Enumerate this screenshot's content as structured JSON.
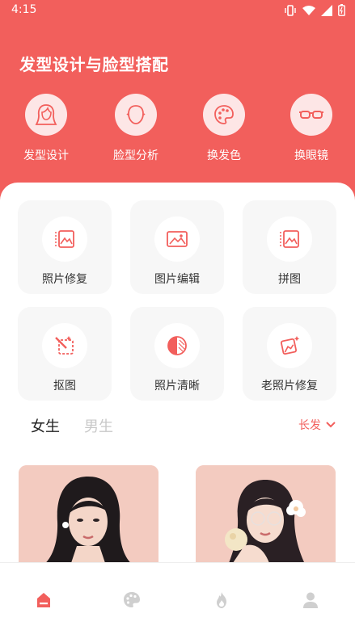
{
  "status_bar": {
    "time": "4:15"
  },
  "page": {
    "title": "发型设计与脸型搭配"
  },
  "features": [
    {
      "label": "发型设计",
      "icon": "woman-hair-icon"
    },
    {
      "label": "脸型分析",
      "icon": "face-shape-icon"
    },
    {
      "label": "换发色",
      "icon": "palette-icon"
    },
    {
      "label": "换眼镜",
      "icon": "glasses-icon"
    }
  ],
  "tools": [
    {
      "label": "照片修复",
      "icon": "photo-restore-icon"
    },
    {
      "label": "图片编辑",
      "icon": "image-edit-icon"
    },
    {
      "label": "拼图",
      "icon": "collage-icon"
    },
    {
      "label": "抠图",
      "icon": "cutout-icon"
    },
    {
      "label": "照片清晰",
      "icon": "sharpen-icon"
    },
    {
      "label": "老照片修复",
      "icon": "old-photo-restore-icon"
    }
  ],
  "gender_tabs": {
    "female": "女生",
    "male": "男生",
    "selected": "female"
  },
  "filter": {
    "label": "长发"
  },
  "colors": {
    "accent": "#f25f5c",
    "accent_light": "#fde6e6",
    "card_bg": "#f7f7f7",
    "photo_bg": "#f3cbc0"
  },
  "bottom_nav": [
    {
      "icon": "home-icon",
      "active": true
    },
    {
      "icon": "palette-icon",
      "active": false
    },
    {
      "icon": "flame-icon",
      "active": false
    },
    {
      "icon": "profile-icon",
      "active": false
    }
  ]
}
